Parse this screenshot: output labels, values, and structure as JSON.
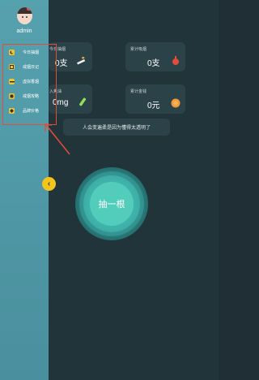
{
  "stats": {
    "today_label": "今日抽烟",
    "today_value": "0支",
    "total_smoked_label": "累计吸烟",
    "total_smoked_value": "0支",
    "tar_label": "入焦油",
    "tar_value": "0mg",
    "money_label": "累计金钱",
    "money_value": "0元"
  },
  "quote": "人会变遍柔是因为懂得太透明了",
  "action_button": "抽一根",
  "drawer": {
    "username": "admin",
    "items": [
      {
        "label": "今日抽烟",
        "icon": "moon-icon"
      },
      {
        "label": "戒烟日记",
        "icon": "diary-icon"
      },
      {
        "label": "虚拟香烟",
        "icon": "cigarette-icon"
      },
      {
        "label": "戒烟攻略",
        "icon": "guide-icon"
      },
      {
        "label": "品牌价格",
        "icon": "price-tag-icon"
      }
    ],
    "toggle_icon": "chevron-left-icon"
  },
  "colors": {
    "accent": "#f2c41c",
    "highlight": "#e24c3a",
    "drawer": "#56a1ae",
    "background": "#20343a"
  }
}
